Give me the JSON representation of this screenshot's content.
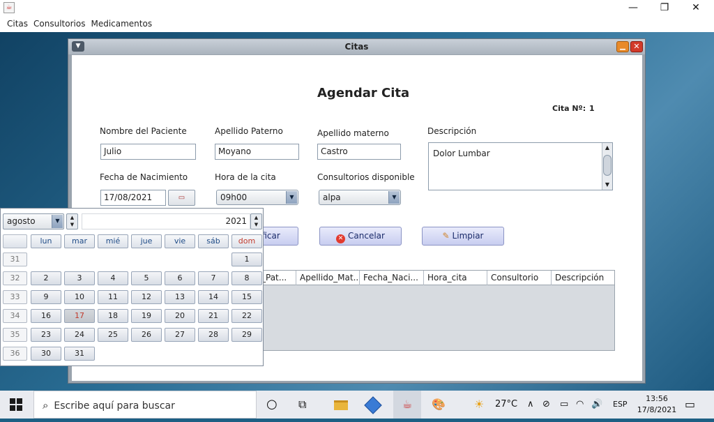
{
  "menubar": [
    "Citas",
    "Consultorios",
    "Medicamentos"
  ],
  "window": {
    "title": "Citas"
  },
  "form": {
    "heading": "Agendar Cita",
    "cita_label": "Cita Nº:",
    "cita_number": "1",
    "nombre_label": "Nombre del Paciente",
    "nombre_value": "Julio",
    "ap_paterno_label": "Apellido Paterno",
    "ap_paterno_value": "Moyano",
    "ap_materno_label": "Apellido materno",
    "ap_materno_value": "Castro",
    "descripcion_label": "Descripción",
    "descripcion_value": "Dolor Lumbar",
    "fecha_label": "Fecha de Nacimiento",
    "fecha_value": "17/08/2021",
    "hora_label": "Hora de la cita",
    "hora_value": "09h00",
    "consultorio_label": "Consultorios disponible",
    "consultorio_value": "alpa"
  },
  "buttons": {
    "modificar": "ificar",
    "cancelar": "Cancelar",
    "limpiar": "Limpiar"
  },
  "table": {
    "headers": [
      "_Pat...",
      "Apellido_Mat...",
      "Fecha_Naci...",
      "Hora_cita",
      "Consultorio",
      "Descripción"
    ]
  },
  "calendar": {
    "month": "agosto",
    "year": "2021",
    "days_header": [
      "lun",
      "mar",
      "mié",
      "jue",
      "vie",
      "sáb",
      "dom"
    ],
    "week_numbers": [
      "31",
      "32",
      "33",
      "34",
      "35",
      "36"
    ],
    "weeks": [
      [
        "",
        "",
        "",
        "",
        "",
        "",
        "1"
      ],
      [
        "2",
        "3",
        "4",
        "5",
        "6",
        "7",
        "8"
      ],
      [
        "9",
        "10",
        "11",
        "12",
        "13",
        "14",
        "15"
      ],
      [
        "16",
        "17",
        "18",
        "19",
        "20",
        "21",
        "22"
      ],
      [
        "23",
        "24",
        "25",
        "26",
        "27",
        "28",
        "29"
      ],
      [
        "30",
        "31",
        "",
        "",
        "",
        "",
        ""
      ]
    ],
    "selected_day": "17"
  },
  "taskbar": {
    "search_placeholder": "Escribe aquí para buscar",
    "weather_temp": "27°C",
    "language": "ESP",
    "time": "13:56",
    "date": "17/8/2021"
  },
  "colors": {
    "accent": "#1d4a86",
    "selected_day_text": "#c0392b",
    "sunday": "#c0392b"
  }
}
